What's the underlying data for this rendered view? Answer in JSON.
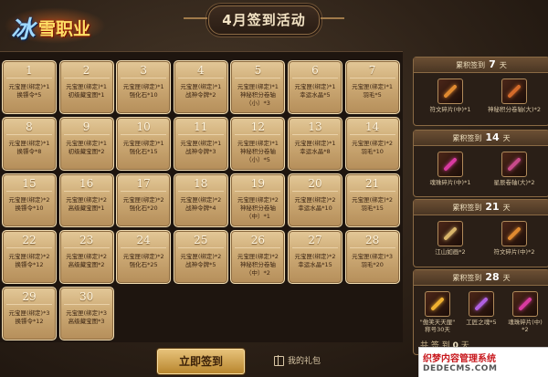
{
  "logo": {
    "text1": "冰",
    "text2": "雪职业"
  },
  "title": "4月签到活动",
  "days": [
    {
      "day": "1",
      "reward1": "元宝匣(绑定)*1",
      "reward2": "换镖令*5"
    },
    {
      "day": "2",
      "reward1": "元宝匣(绑定)*1",
      "reward2": "初级藏宝图*1"
    },
    {
      "day": "3",
      "reward1": "元宝匣(绑定)*1",
      "reward2": "强化石*10"
    },
    {
      "day": "4",
      "reward1": "元宝匣(绑定)*1",
      "reward2": "战神令牌*2"
    },
    {
      "day": "5",
      "reward1": "元宝匣(绑定)*1",
      "reward2": "神秘积分卷轴",
      "reward3": "（小）*3"
    },
    {
      "day": "6",
      "reward1": "元宝匣(绑定)*1",
      "reward2": "幸运水晶*5"
    },
    {
      "day": "7",
      "reward1": "元宝匣(绑定)*1",
      "reward2": "羽毛*5"
    },
    {
      "day": "8",
      "reward1": "元宝匣(绑定)*1",
      "reward2": "换镖令*8"
    },
    {
      "day": "9",
      "reward1": "元宝匣(绑定)*1",
      "reward2": "初级藏宝图*2"
    },
    {
      "day": "10",
      "reward1": "元宝匣(绑定)*1",
      "reward2": "强化石*15"
    },
    {
      "day": "11",
      "reward1": "元宝匣(绑定)*1",
      "reward2": "战神令牌*3"
    },
    {
      "day": "12",
      "reward1": "元宝匣(绑定)*1",
      "reward2": "神秘积分卷轴",
      "reward3": "（小）*5"
    },
    {
      "day": "13",
      "reward1": "元宝匣(绑定)*1",
      "reward2": "幸运水晶*8"
    },
    {
      "day": "14",
      "reward1": "元宝匣(绑定)*2",
      "reward2": "羽毛*10"
    },
    {
      "day": "15",
      "reward1": "元宝匣(绑定)*2",
      "reward2": "换镖令*10"
    },
    {
      "day": "16",
      "reward1": "元宝匣(绑定)*2",
      "reward2": "高级藏宝图*1"
    },
    {
      "day": "17",
      "reward1": "元宝匣(绑定)*2",
      "reward2": "强化石*20"
    },
    {
      "day": "18",
      "reward1": "元宝匣(绑定)*2",
      "reward2": "战神令牌*4"
    },
    {
      "day": "19",
      "reward1": "元宝匣(绑定)*2",
      "reward2": "神秘积分卷轴",
      "reward3": "（中）*1"
    },
    {
      "day": "20",
      "reward1": "元宝匣(绑定)*2",
      "reward2": "幸运水晶*10"
    },
    {
      "day": "21",
      "reward1": "元宝匣(绑定)*2",
      "reward2": "羽毛*15"
    },
    {
      "day": "22",
      "reward1": "元宝匣(绑定)*2",
      "reward2": "换镖令*12"
    },
    {
      "day": "23",
      "reward1": "元宝匣(绑定)*2",
      "reward2": "高级藏宝图*2"
    },
    {
      "day": "24",
      "reward1": "元宝匣(绑定)*2",
      "reward2": "强化石*25"
    },
    {
      "day": "25",
      "reward1": "元宝匣(绑定)*2",
      "reward2": "战神令牌*5"
    },
    {
      "day": "26",
      "reward1": "元宝匣(绑定)*2",
      "reward2": "神秘积分卷轴",
      "reward3": "（中）*2"
    },
    {
      "day": "27",
      "reward1": "元宝匣(绑定)*2",
      "reward2": "幸运水晶*15"
    },
    {
      "day": "28",
      "reward1": "元宝匣(绑定)*3",
      "reward2": "羽毛*20"
    },
    {
      "day": "29",
      "reward1": "元宝匣(绑定)*3",
      "reward2": "换镖令*12"
    },
    {
      "day": "30",
      "reward1": "元宝匣(绑定)*3",
      "reward2": "高级藏宝图*3"
    }
  ],
  "cumulative": [
    {
      "label_pre": "累积签到",
      "days": "7",
      "label_post": "天",
      "items": [
        {
          "name": "符文碎片(中)*1",
          "icon": "scroll-icon",
          "color": "#e08a30"
        },
        {
          "name": "神秘积分卷轴(大)*2",
          "icon": "scroll-icon",
          "color": "#d46a2a"
        }
      ]
    },
    {
      "label_pre": "累积签到",
      "days": "14",
      "label_post": "天",
      "items": [
        {
          "name": "魂珠碎片(中)*1",
          "icon": "shard-icon",
          "color": "#d83aa0"
        },
        {
          "name": "星辰卷轴(大)*2",
          "icon": "scroll-icon",
          "color": "#c84a8a"
        }
      ]
    },
    {
      "label_pre": "累积签到",
      "days": "21",
      "label_post": "天",
      "items": [
        {
          "name": "江山如画*2",
          "icon": "painting-icon",
          "color": "#d8b46a"
        },
        {
          "name": "符文碎片(中)*2",
          "icon": "scroll-icon",
          "color": "#e08a30"
        }
      ]
    },
    {
      "label_pre": "累积签到",
      "days": "28",
      "label_post": "天",
      "items": [
        {
          "name": "\"傲笑天天厘\"",
          "name2": "称号30天",
          "icon": "title-badge-icon",
          "color": "#f0b030"
        },
        {
          "name": "工匠之魂*5",
          "icon": "soul-gem-icon",
          "color": "#b060e0"
        },
        {
          "name": "魂珠碎片(中)",
          "name2": "*2",
          "icon": "shard-icon",
          "color": "#d83aa0"
        }
      ]
    }
  ],
  "buttons": {
    "signin": "立即签到",
    "gift": "我的礼包"
  },
  "summary": {
    "pre": "共 签 到",
    "count": "0",
    "post": "天"
  },
  "watermark": {
    "line1": "织梦内容管理系统",
    "line2": "DEDECMS.COM"
  }
}
